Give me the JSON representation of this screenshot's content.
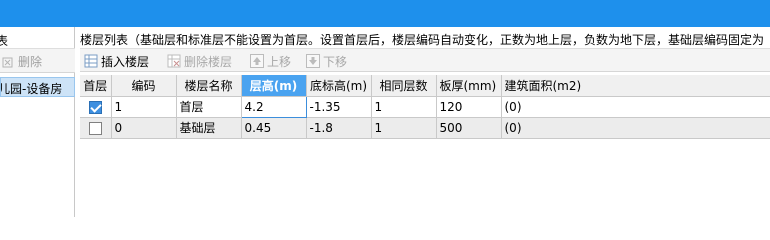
{
  "left": {
    "title": "表",
    "delete_label": "删除",
    "selected_item": "儿园-设备房"
  },
  "right": {
    "title": "楼层列表（基础层和标准层不能设置为首层。设置首层后，楼层编码自动变化，正数为地上层，负数为地下层，基础层编码固定为（"
  },
  "toolbar": {
    "insert_label": "插入楼层",
    "delete_label": "删除楼层",
    "up_label": "上移",
    "down_label": "下移"
  },
  "table": {
    "headers": [
      "首层",
      "编码",
      "楼层名称",
      "层高(m)",
      "底标高(m)",
      "相同层数",
      "板厚(mm)",
      "建筑面积(m2)"
    ],
    "selected_header": "层高(m)",
    "rows": [
      {
        "first_floor": true,
        "code": "1",
        "name": "首层",
        "height": "4.2",
        "bottom": "-1.35",
        "same": "1",
        "slab": "120",
        "area": "(0)"
      },
      {
        "first_floor": false,
        "code": "0",
        "name": "基础层",
        "height": "0.45",
        "bottom": "-1.8",
        "same": "1",
        "slab": "500",
        "area": "(0)"
      }
    ]
  },
  "colors": {
    "titlebar": "#1e90ec",
    "selected_header": "#4aa3f0",
    "checkbox_checked": "#3d8fe0"
  }
}
